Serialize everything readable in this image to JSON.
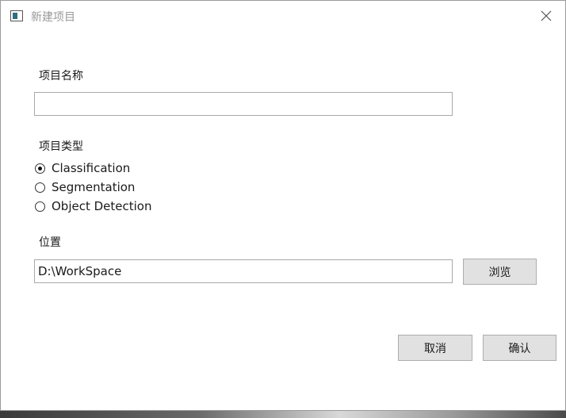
{
  "window": {
    "title": "新建项目",
    "icons": {
      "app": "window-app-icon",
      "close": "close-icon"
    }
  },
  "form": {
    "name_label": "项目名称",
    "name_value": "",
    "type_label": "项目类型",
    "types": [
      {
        "label": "Classification",
        "checked": true
      },
      {
        "label": "Segmentation",
        "checked": false
      },
      {
        "label": "Object Detection",
        "checked": false
      }
    ],
    "location_label": "位置",
    "location_value": "D:\\WorkSpace",
    "browse_label": "浏览"
  },
  "footer": {
    "cancel_label": "取消",
    "confirm_label": "确认"
  }
}
